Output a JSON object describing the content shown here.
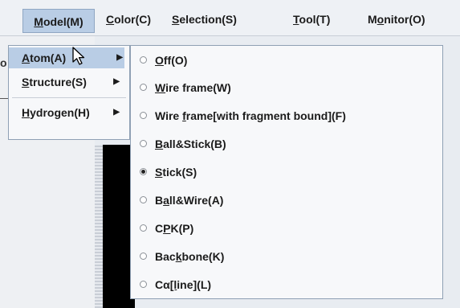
{
  "menubar": {
    "model": {
      "label": "Model(M)",
      "mnemonic": "M",
      "rest": "odel(M)"
    },
    "color": {
      "mnemonic": "C",
      "rest": "olor(C)"
    },
    "selection": {
      "mnemonic": "S",
      "rest": "election(S)"
    },
    "tool": {
      "mnemonic": "T",
      "rest": "ool(T)"
    },
    "monitor": {
      "pre": "M",
      "mnemonic": "o",
      "rest": "nitor(O)"
    }
  },
  "model_menu": {
    "items": [
      {
        "mnemonic": "A",
        "rest": "tom(A)"
      },
      {
        "mnemonic": "S",
        "rest": "tructure(S)"
      },
      {
        "mnemonic": "H",
        "rest": "ydrogen(H)"
      }
    ]
  },
  "atom_menu": {
    "items": [
      {
        "pre": "",
        "mnemonic": "O",
        "rest": "ff(O)",
        "selected": false
      },
      {
        "pre": "",
        "mnemonic": "W",
        "rest": "ire frame(W)",
        "selected": false
      },
      {
        "pre": "Wire ",
        "mnemonic": "f",
        "rest": "rame[with fragment bound](F)",
        "selected": false
      },
      {
        "pre": "",
        "mnemonic": "B",
        "rest": "all&Stick(B)",
        "selected": false
      },
      {
        "pre": "",
        "mnemonic": "S",
        "rest": "tick(S)",
        "selected": true
      },
      {
        "pre": "B",
        "mnemonic": "a",
        "rest": "ll&Wire(A)",
        "selected": false
      },
      {
        "pre": "C",
        "mnemonic": "P",
        "rest": "K(P)",
        "selected": false
      },
      {
        "pre": "Bac",
        "mnemonic": "k",
        "rest": "bone(K)",
        "selected": false
      },
      {
        "pre": "Cα",
        "mnemonic": "[l",
        "rest": "ine](L)",
        "selected": false
      }
    ]
  },
  "edge_fragment": "o",
  "icons": {
    "submenu_arrow": "▶",
    "cursor": "arrow-pointer"
  }
}
